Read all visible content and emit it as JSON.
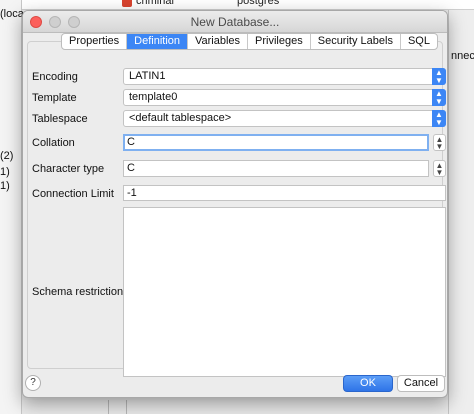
{
  "background": {
    "left_texts": [
      "(loca",
      "(2)",
      "1)",
      "1)"
    ],
    "top_texts": [
      "criminal",
      "postgres"
    ],
    "right_texts": [
      "nnect"
    ]
  },
  "dialog": {
    "title": "New Database...",
    "tabs": [
      {
        "label": "Properties"
      },
      {
        "label": "Definition"
      },
      {
        "label": "Variables"
      },
      {
        "label": "Privileges"
      },
      {
        "label": "Security Labels"
      },
      {
        "label": "SQL"
      }
    ],
    "active_tab": "Definition",
    "fields": {
      "encoding": {
        "label": "Encoding",
        "value": "LATIN1"
      },
      "template": {
        "label": "Template",
        "value": "template0"
      },
      "tablespace": {
        "label": "Tablespace",
        "value": "<default tablespace>"
      },
      "collation": {
        "label": "Collation",
        "value": "C"
      },
      "character_type": {
        "label": "Character type",
        "value": "C"
      },
      "connection_limit": {
        "label": "Connection Limit",
        "value": "-1"
      },
      "schema_restriction": {
        "label": "Schema restriction",
        "value": ""
      }
    },
    "buttons": {
      "help": "?",
      "ok": "OK",
      "cancel": "Cancel"
    }
  },
  "icons": {
    "select_arrows": "⌃⌄",
    "stepper_arrows": "⌃⌄",
    "help_icon": "question-mark"
  },
  "colors": {
    "accent": "#3c86f5",
    "close_button": "#fc605c",
    "focus_ring": "#7fb0f0"
  }
}
